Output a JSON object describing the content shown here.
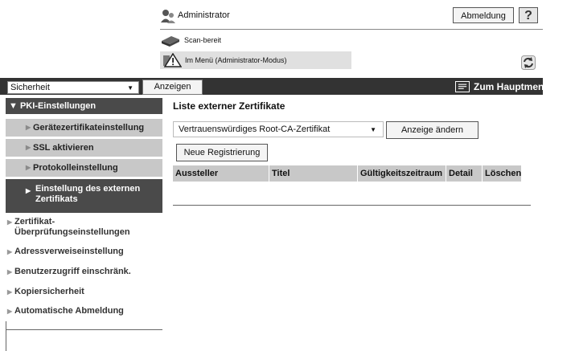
{
  "header": {
    "user": "Administrator",
    "logout_label": "Abmeldung",
    "help_label": "?",
    "scan_status": "Scan-bereit",
    "mode_text": "Im Menü (Administrator-Modus)"
  },
  "nav": {
    "category_select": "Sicherheit",
    "show_label": "Anzeigen",
    "home_label": "Zum Hauptmenü"
  },
  "sidebar": {
    "section_header": "PKI-Einstellungen",
    "sub_items": [
      {
        "label": "Gerätezertifikateinstellung"
      },
      {
        "label": "SSL aktivieren"
      },
      {
        "label": "Protokolleinstellung"
      }
    ],
    "selected_item": {
      "line1": "Einstellung des externen",
      "line2": "Zertifikats"
    },
    "main_items": [
      {
        "line1": "Zertifikat-",
        "line2": "Überprüfungseinstellungen"
      },
      {
        "line1": "Adressverweiseinstellung",
        "line2": ""
      },
      {
        "line1": "Benutzerzugriff einschränk.",
        "line2": ""
      },
      {
        "line1": "Kopiersicherheit",
        "line2": ""
      },
      {
        "line1": "Automatische Abmeldung",
        "line2": ""
      }
    ]
  },
  "main": {
    "title": "Liste externer Zertifikate",
    "cert_type_select": "Vertrauenswürdiges Root-CA-Zertifikat",
    "change_display_label": "Anzeige ändern",
    "new_registration_label": "Neue Registrierung",
    "table_columns": [
      "Aussteller",
      "Titel",
      "Gültigkeitszeitraum",
      "Detail",
      "Löschen"
    ]
  },
  "icons": {
    "admin": "admin-user-icon",
    "scanner": "scanner-icon",
    "warning": "warning-icon",
    "refresh": "refresh-icon",
    "home": "home-icon",
    "caret": "caret-down-icon"
  }
}
